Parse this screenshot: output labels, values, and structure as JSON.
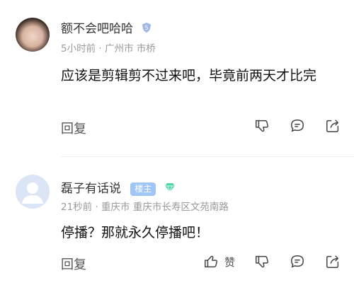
{
  "comments": [
    {
      "username": "额不会吧哈哈",
      "level": "5",
      "meta": "5小时前 · 广州市 市桥",
      "content": "应该是剪辑剪不过来吧，毕竟前两天才比完",
      "reply_label": "回复"
    },
    {
      "username": "磊子有话说",
      "host_badge": "楼主",
      "meta": "21秒前 · 重庆市 重庆市长寿区文苑南路",
      "content": "停播？那就永久停播吧！",
      "reply_label": "回复",
      "like_label": "赞"
    }
  ],
  "colors": {
    "level_badge": "#9fb8e8",
    "host_badge": "#9fc6f5",
    "vip_gem": "#53d6b0"
  },
  "icons": [
    "thumbs-down-icon",
    "comment-icon",
    "share-icon",
    "thumbs-up-icon",
    "level-shield-icon",
    "vip-gem-icon"
  ]
}
